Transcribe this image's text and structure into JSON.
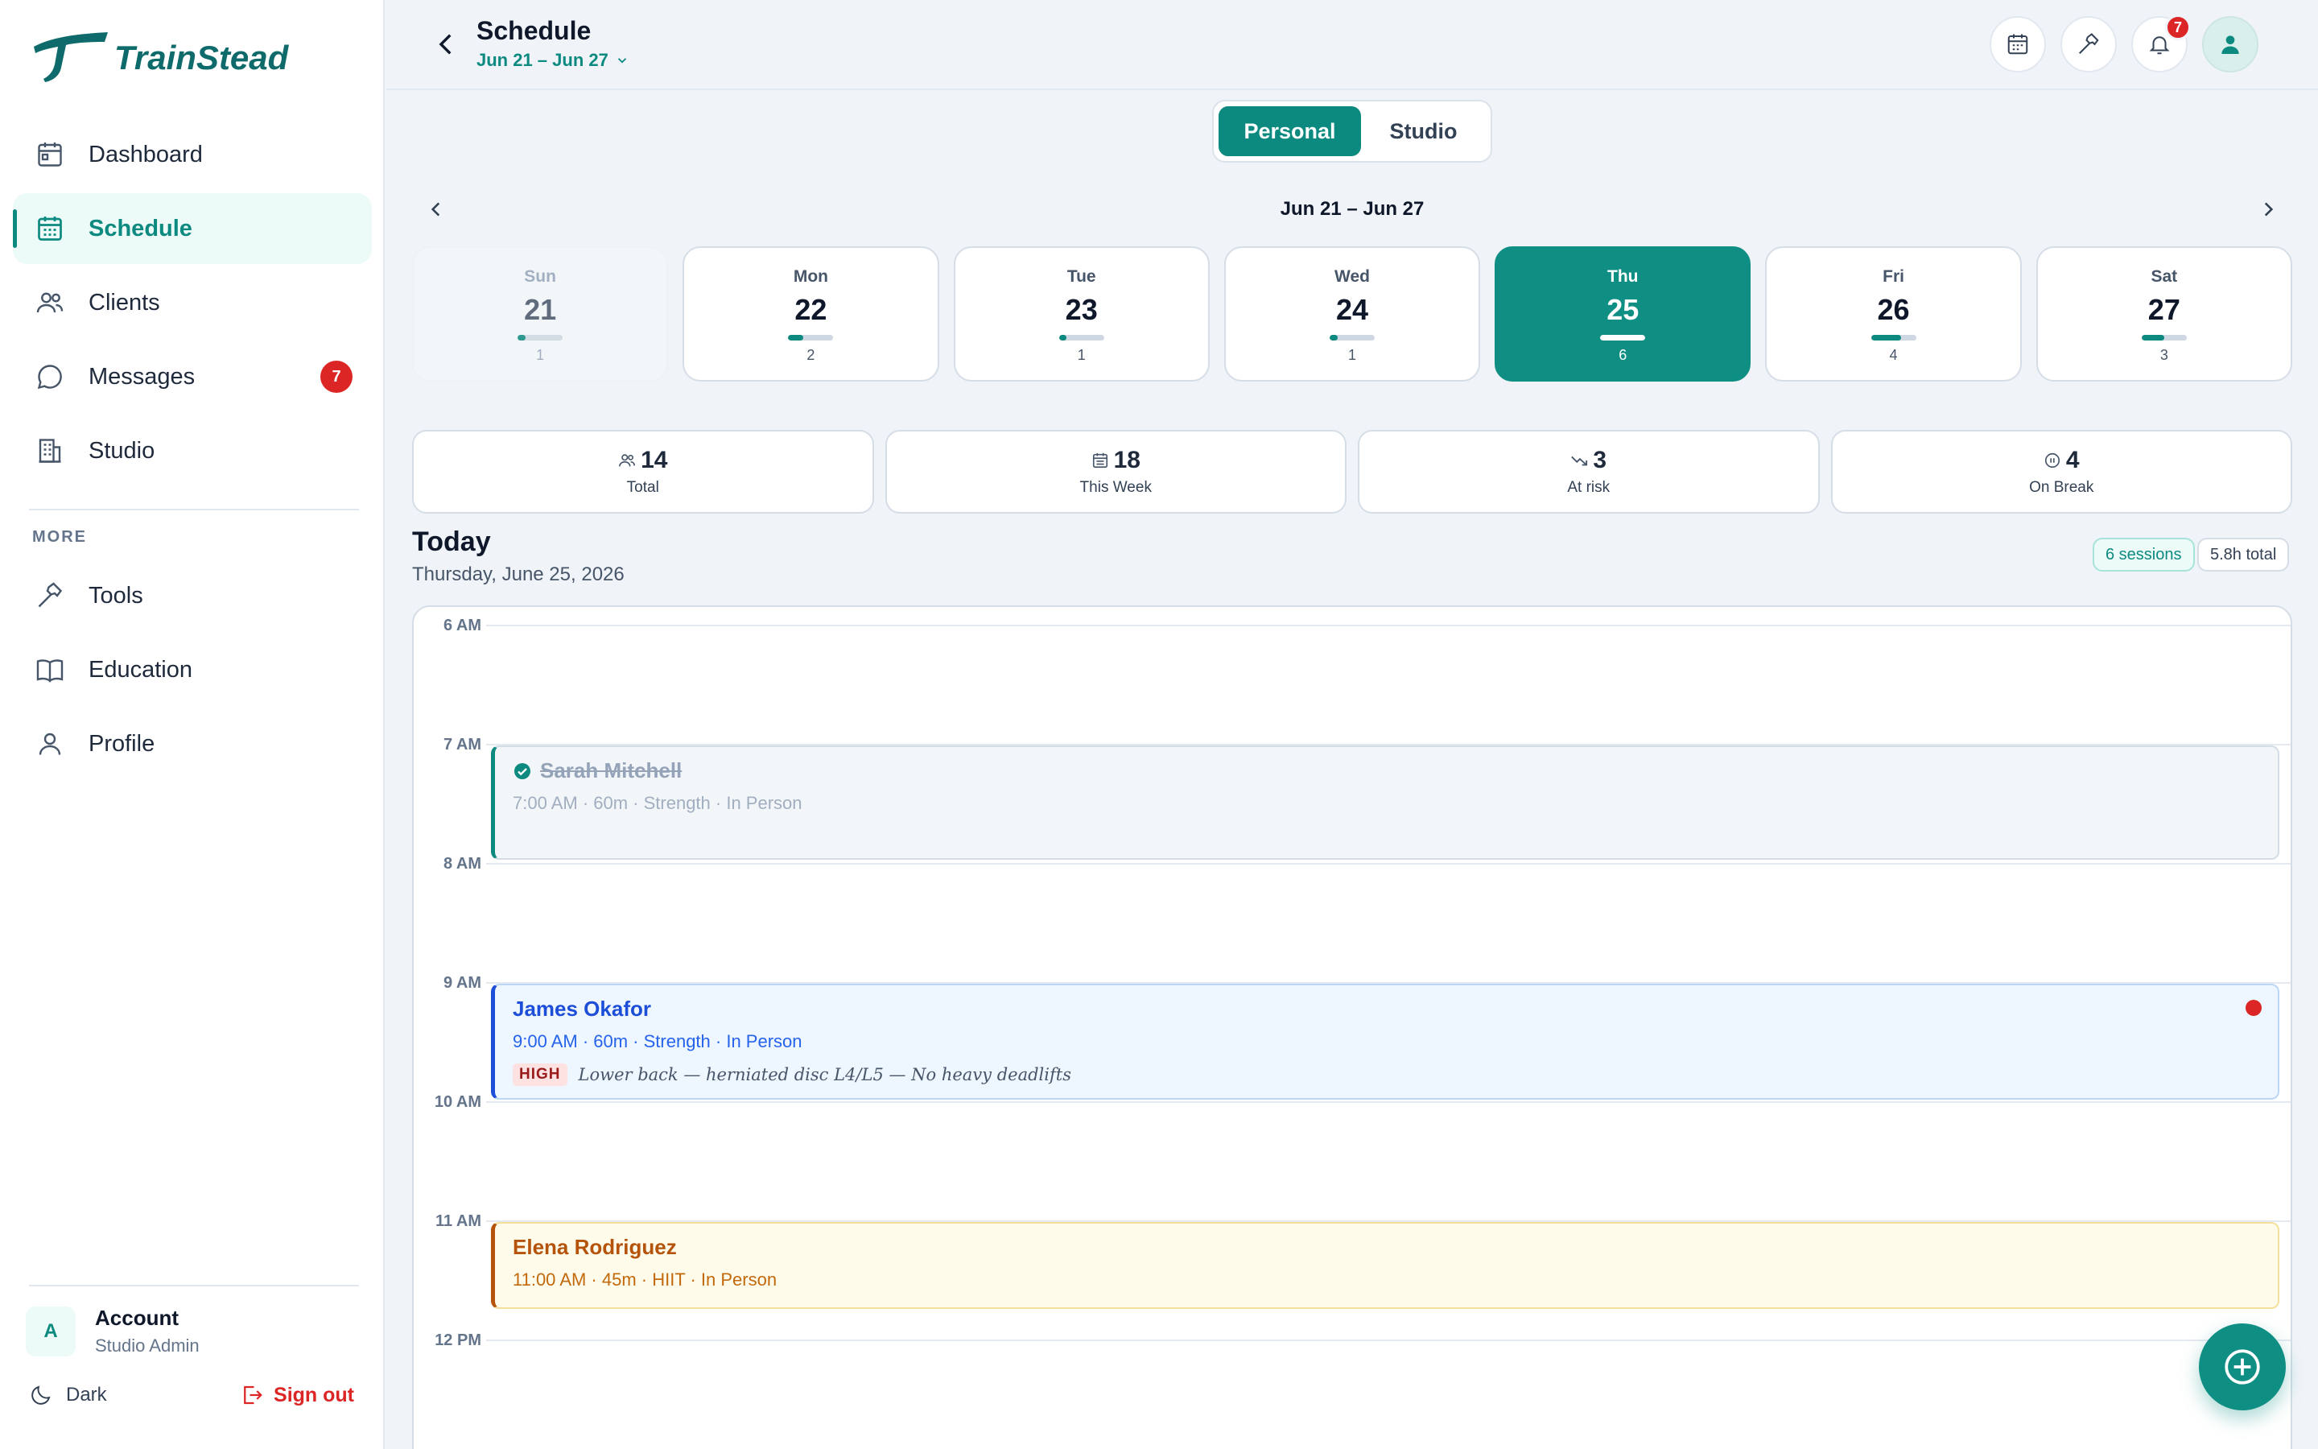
{
  "app": {
    "name": "TrainStead"
  },
  "sidebar": {
    "items": [
      {
        "label": "Dashboard",
        "icon": "dashboard-icon"
      },
      {
        "label": "Schedule",
        "icon": "calendar-icon",
        "active": true
      },
      {
        "label": "Clients",
        "icon": "users-icon"
      },
      {
        "label": "Messages",
        "icon": "message-icon",
        "badge": "7"
      },
      {
        "label": "Studio",
        "icon": "building-icon"
      }
    ],
    "more_label": "MORE",
    "more_items": [
      {
        "label": "Tools",
        "icon": "hammer-icon"
      },
      {
        "label": "Education",
        "icon": "book-icon"
      },
      {
        "label": "Profile",
        "icon": "user-icon"
      }
    ],
    "account": {
      "initial": "A",
      "name": "Account",
      "role": "Studio Admin"
    },
    "theme_label": "Dark",
    "signout_label": "Sign out"
  },
  "header": {
    "title": "Schedule",
    "range": "Jun 21 – Jun 27",
    "notification_count": "7"
  },
  "view_toggle": {
    "options": [
      "Personal",
      "Studio"
    ],
    "selected": "Personal"
  },
  "week": {
    "label": "Jun 21 – Jun 27",
    "days": [
      {
        "name": "Sun",
        "num": "21",
        "count": "1",
        "load": 0.17,
        "state": "past"
      },
      {
        "name": "Mon",
        "num": "22",
        "count": "2",
        "load": 0.33,
        "state": "normal"
      },
      {
        "name": "Tue",
        "num": "23",
        "count": "1",
        "load": 0.17,
        "state": "normal"
      },
      {
        "name": "Wed",
        "num": "24",
        "count": "1",
        "load": 0.17,
        "state": "normal"
      },
      {
        "name": "Thu",
        "num": "25",
        "count": "6",
        "load": 1.0,
        "state": "selected"
      },
      {
        "name": "Fri",
        "num": "26",
        "count": "4",
        "load": 0.67,
        "state": "normal"
      },
      {
        "name": "Sat",
        "num": "27",
        "count": "3",
        "load": 0.5,
        "state": "normal"
      }
    ]
  },
  "stats": [
    {
      "value": "14",
      "label": "Total",
      "icon": "users-icon"
    },
    {
      "value": "18",
      "label": "This Week",
      "icon": "calendar-icon"
    },
    {
      "value": "3",
      "label": "At risk",
      "icon": "trend-down-icon"
    },
    {
      "value": "4",
      "label": "On Break",
      "icon": "pause-icon"
    }
  ],
  "today": {
    "title": "Today",
    "date": "Thursday, June 25, 2026",
    "sessions_pill": "6 sessions",
    "total_pill": "5.8h total"
  },
  "timeline": {
    "hours": [
      "6 AM",
      "7 AM",
      "8 AM",
      "9 AM",
      "10 AM",
      "11 AM",
      "12 PM"
    ],
    "events": [
      {
        "name": "Sarah Mitchell",
        "meta": "7:00 AM · 60m · Strength · In Person",
        "status": "completed"
      },
      {
        "name": "James Okafor",
        "meta": "9:00 AM · 60m · Strength · In Person",
        "risk_tag": "HIGH",
        "risk_note": "Lower back — herniated disc L4/L5 — No heavy deadlifts"
      },
      {
        "name": "Elena Rodriguez",
        "meta": "11:00 AM · 45m · HIIT · In Person"
      }
    ]
  },
  "colors": {
    "brand": "#0d8a80",
    "danger": "#dc2626",
    "info": "#1d4ed8",
    "warning": "#b45309"
  }
}
